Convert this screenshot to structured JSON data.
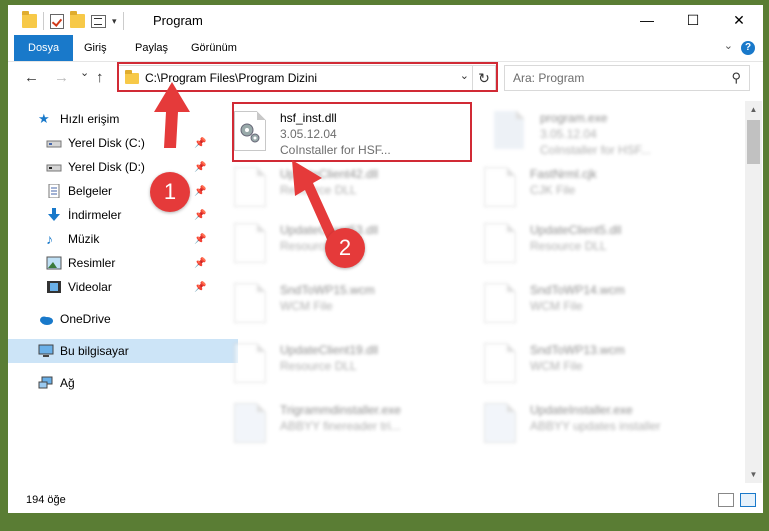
{
  "window": {
    "title": "Program",
    "controls": {
      "minimize": "—",
      "maximize": "☐",
      "close": "✕"
    }
  },
  "ribbon": {
    "tabs": [
      "Dosya",
      "Giriş",
      "Paylaş",
      "Görünüm"
    ],
    "active_tab": "Dosya",
    "collapse_icon": "chevron-down-icon",
    "help_label": "?"
  },
  "navigation": {
    "back": "←",
    "forward": "→",
    "recent": "⌄",
    "up": "↑",
    "address": "C:\\Program Files\\Program Dizini",
    "search_placeholder": "Ara: Program"
  },
  "sidebar": {
    "items": [
      {
        "label": "Hızlı erişim",
        "icon": "star-icon",
        "pinned": false
      },
      {
        "label": "Yerel Disk (C:)",
        "icon": "drive-icon",
        "pinned": true
      },
      {
        "label": "Yerel Disk (D:)",
        "icon": "drive-icon",
        "pinned": true
      },
      {
        "label": "Belgeler",
        "icon": "documents-icon",
        "pinned": true
      },
      {
        "label": "İndirmeler",
        "icon": "download-icon",
        "pinned": true
      },
      {
        "label": "Müzik",
        "icon": "music-icon",
        "pinned": true
      },
      {
        "label": "Resimler",
        "icon": "pictures-icon",
        "pinned": true
      },
      {
        "label": "Videolar",
        "icon": "videos-icon",
        "pinned": true
      },
      {
        "label": "OneDrive",
        "icon": "cloud-icon",
        "pinned": false
      },
      {
        "label": "Bu bilgisayar",
        "icon": "computer-icon",
        "pinned": false,
        "selected": true
      },
      {
        "label": "Ağ",
        "icon": "network-icon",
        "pinned": false
      }
    ]
  },
  "files": [
    {
      "name": "hsf_inst.dll",
      "line1": "3.05.12.04",
      "line2": "CoInstaller for HSF...",
      "icon": "gear-dll-icon",
      "highlighted": true
    },
    {
      "name": "program.exe",
      "line1": "3.05.12.04",
      "line2": "CoInstaller for HSF...",
      "icon": "app-icon"
    },
    {
      "name": "UpdateClient42.dll",
      "line1": "Resource DLL",
      "line2": "",
      "icon": "gear-dll-icon"
    },
    {
      "name": "FastNrml.cjk",
      "line1": "CJK File",
      "line2": "",
      "icon": "blank-file-icon"
    },
    {
      "name": "UpdateClient53.dll",
      "line1": "Resource DLL",
      "line2": "",
      "icon": "gear-dll-icon"
    },
    {
      "name": "UpdateClient5.dll",
      "line1": "Resource DLL",
      "line2": "",
      "icon": "gear-dll-icon"
    },
    {
      "name": "SndToWP15.wcm",
      "line1": "WCM File",
      "line2": "",
      "icon": "blank-file-icon"
    },
    {
      "name": "SndToWP14.wcm",
      "line1": "WCM File",
      "line2": "",
      "icon": "blank-file-icon"
    },
    {
      "name": "UpdateClient19.dll",
      "line1": "Resource DLL",
      "line2": "",
      "icon": "gear-dll-icon"
    },
    {
      "name": "SndToWP13.wcm",
      "line1": "WCM File",
      "line2": "",
      "icon": "blank-file-icon"
    },
    {
      "name": "Trigrammdinstaller.exe",
      "line1": "ABBYY finereader tri...",
      "line2": "",
      "icon": "installer-icon"
    },
    {
      "name": "UpdateInstaller.exe",
      "line1": "ABBYY updates installer",
      "line2": "",
      "icon": "installer-icon"
    }
  ],
  "status": {
    "item_count": "194 öğe"
  },
  "annotations": {
    "step1": "1",
    "step2": "2",
    "highlight_color": "#d12a35",
    "badge_color": "#e53a3a"
  },
  "colors": {
    "accent": "#1979ca",
    "selected_bg": "#cce4f7"
  }
}
